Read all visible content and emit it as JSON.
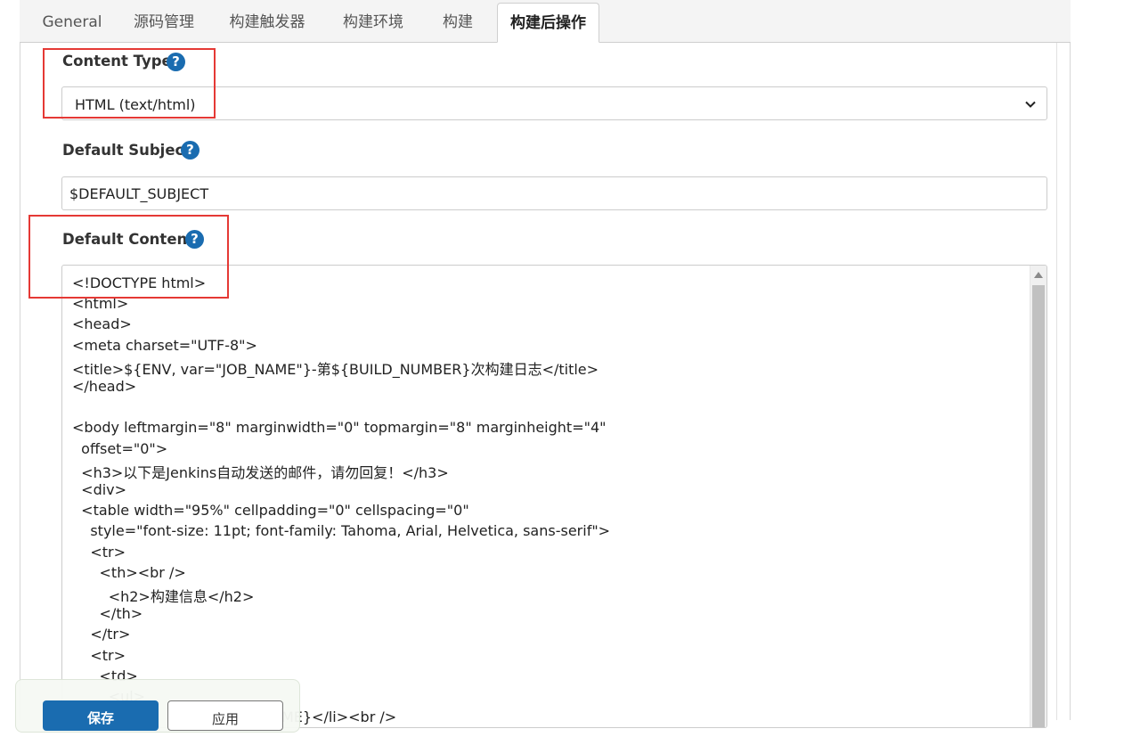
{
  "tabs": [
    {
      "label": "General"
    },
    {
      "label": "源码管理"
    },
    {
      "label": "构建触发器"
    },
    {
      "label": "构建环境"
    },
    {
      "label": "构建"
    },
    {
      "label": "构建后操作"
    }
  ],
  "content_type": {
    "label": "Content Type",
    "help": "?",
    "selected": "HTML (text/html)"
  },
  "default_subject": {
    "label": "Default Subject",
    "help": "?",
    "value": "$DEFAULT_SUBJECT"
  },
  "default_content": {
    "label": "Default Content",
    "help": "?",
    "lines": [
      "<!DOCTYPE html>",
      "<html>",
      "<head>",
      "<meta charset=\"UTF-8\">",
      "<title>${ENV, var=\"JOB_NAME\"}-第${BUILD_NUMBER}次构建日志</title>",
      "</head>",
      "",
      "<body leftmargin=\"8\" marginwidth=\"0\" topmargin=\"8\" marginheight=\"4\"",
      "  offset=\"0\">",
      "  <h3>以下是Jenkins自动发送的邮件，请勿回复！</h3>",
      "  <div>",
      "  <table width=\"95%\" cellpadding=\"0\" cellspacing=\"0\"",
      "    style=\"font-size: 11pt; font-family: Tahoma, Arial, Helvetica, sans-serif\">",
      "    <tr>",
      "      <th><br />",
      "        <h2>构建信息</h2>",
      "      </th>",
      "    </tr>",
      "    <tr>",
      "      <td>",
      "        <ul>",
      "                                    CT_NAME}</li><br />"
    ]
  },
  "footer": {
    "save_label": "保存",
    "apply_label": "应用"
  },
  "colors": {
    "accent": "#1a6cb0",
    "highlight": "#e53935"
  }
}
